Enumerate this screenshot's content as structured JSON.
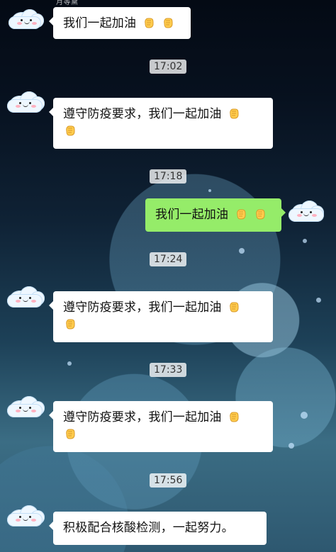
{
  "chat": {
    "top_label": "月等黛",
    "messages": [
      {
        "type": "bubble",
        "side": "left",
        "text": "我们一起加油",
        "emoji_count": 2
      },
      {
        "type": "time",
        "text": "17:02"
      },
      {
        "type": "bubble",
        "side": "left",
        "text": "遵守防疫要求，我们一起加油",
        "emoji_count": 2
      },
      {
        "type": "time",
        "text": "17:18"
      },
      {
        "type": "bubble",
        "side": "right",
        "text": "我们一起加油",
        "emoji_count": 2
      },
      {
        "type": "time",
        "text": "17:24"
      },
      {
        "type": "bubble",
        "side": "left",
        "text": "遵守防疫要求，我们一起加油",
        "emoji_count": 2
      },
      {
        "type": "time",
        "text": "17:33"
      },
      {
        "type": "bubble",
        "side": "left",
        "text": "遵守防疫要求，我们一起加油",
        "emoji_count": 2
      },
      {
        "type": "time",
        "text": "17:56"
      },
      {
        "type": "bubble",
        "side": "left",
        "text": "积极配合核酸检测，一起努力。",
        "emoji_count": 0
      }
    ]
  },
  "theme": {
    "accent_green": "#95ec69",
    "bubble_white": "#ffffff",
    "time_chip": "#d9d9d9"
  }
}
